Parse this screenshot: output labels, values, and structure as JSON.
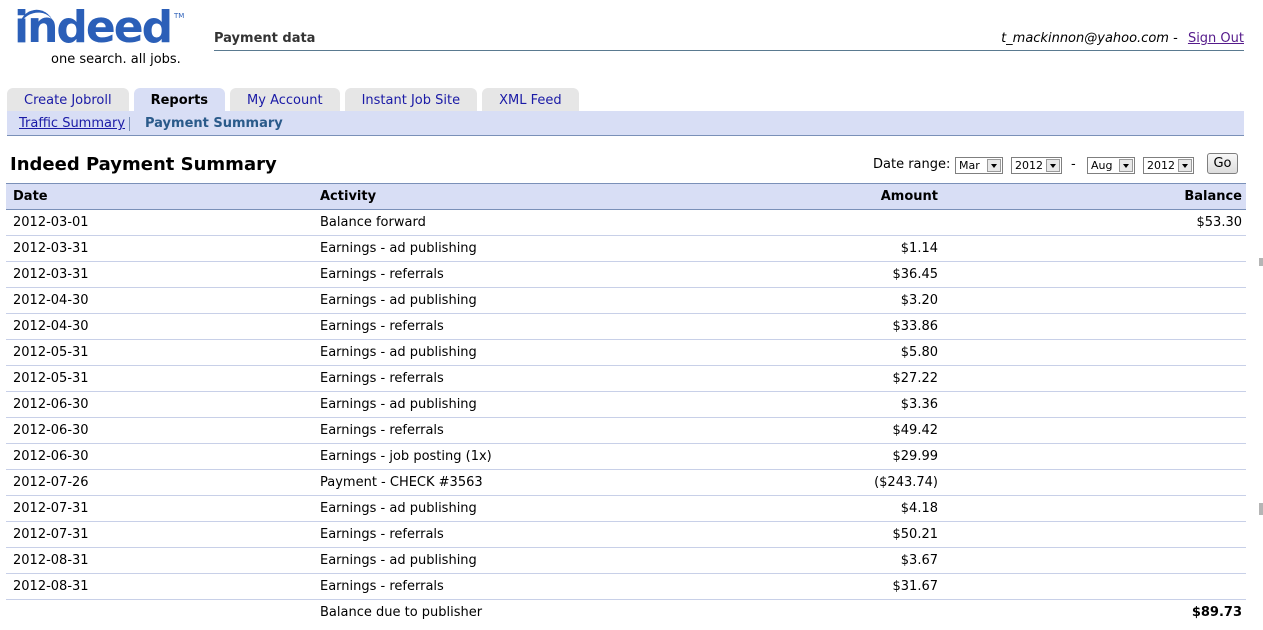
{
  "brand": {
    "name": "indeed",
    "tagline": "one search. all jobs.",
    "tm": "TM",
    "color": "#2b5fb8"
  },
  "header": {
    "page_title": "Payment data",
    "user_email": "t_mackinnon@yahoo.com",
    "separator": "-",
    "sign_out": "Sign Out"
  },
  "tabs": [
    {
      "label": "Create Jobroll",
      "active": false
    },
    {
      "label": "Reports",
      "active": true
    },
    {
      "label": "My Account",
      "active": false
    },
    {
      "label": "Instant Job Site",
      "active": false
    },
    {
      "label": "XML Feed",
      "active": false
    }
  ],
  "subnav": {
    "traffic_summary": "Traffic Summary",
    "payment_summary": "Payment Summary"
  },
  "summary": {
    "title": "Indeed Payment Summary",
    "date_range_label": "Date range:",
    "from_month": "Mar",
    "from_year": "2012",
    "range_separator": "-",
    "to_month": "Aug",
    "to_year": "2012",
    "go_label": "Go"
  },
  "table": {
    "columns": [
      "Date",
      "Activity",
      "Amount",
      "Balance"
    ],
    "rows": [
      {
        "date": "2012-03-01",
        "activity": "Balance forward",
        "amount": "",
        "balance": "$53.30"
      },
      {
        "date": "2012-03-31",
        "activity": "Earnings - ad publishing",
        "amount": "$1.14",
        "balance": ""
      },
      {
        "date": "2012-03-31",
        "activity": "Earnings - referrals",
        "amount": "$36.45",
        "balance": ""
      },
      {
        "date": "2012-04-30",
        "activity": "Earnings - ad publishing",
        "amount": "$3.20",
        "balance": ""
      },
      {
        "date": "2012-04-30",
        "activity": "Earnings - referrals",
        "amount": "$33.86",
        "balance": ""
      },
      {
        "date": "2012-05-31",
        "activity": "Earnings - ad publishing",
        "amount": "$5.80",
        "balance": ""
      },
      {
        "date": "2012-05-31",
        "activity": "Earnings - referrals",
        "amount": "$27.22",
        "balance": ""
      },
      {
        "date": "2012-06-30",
        "activity": "Earnings - ad publishing",
        "amount": "$3.36",
        "balance": ""
      },
      {
        "date": "2012-06-30",
        "activity": "Earnings - referrals",
        "amount": "$49.42",
        "balance": ""
      },
      {
        "date": "2012-06-30",
        "activity": "Earnings - job posting (1x)",
        "amount": "$29.99",
        "balance": ""
      },
      {
        "date": "2012-07-26",
        "activity": "Payment - CHECK #3563",
        "amount": "($243.74)",
        "balance": ""
      },
      {
        "date": "2012-07-31",
        "activity": "Earnings - ad publishing",
        "amount": "$4.18",
        "balance": ""
      },
      {
        "date": "2012-07-31",
        "activity": "Earnings - referrals",
        "amount": "$50.21",
        "balance": ""
      },
      {
        "date": "2012-08-31",
        "activity": "Earnings - ad publishing",
        "amount": "$3.67",
        "balance": ""
      },
      {
        "date": "2012-08-31",
        "activity": "Earnings - referrals",
        "amount": "$31.67",
        "balance": ""
      }
    ],
    "total": {
      "date": "",
      "activity": "Balance due to publisher",
      "amount": "",
      "balance": "$89.73"
    }
  }
}
